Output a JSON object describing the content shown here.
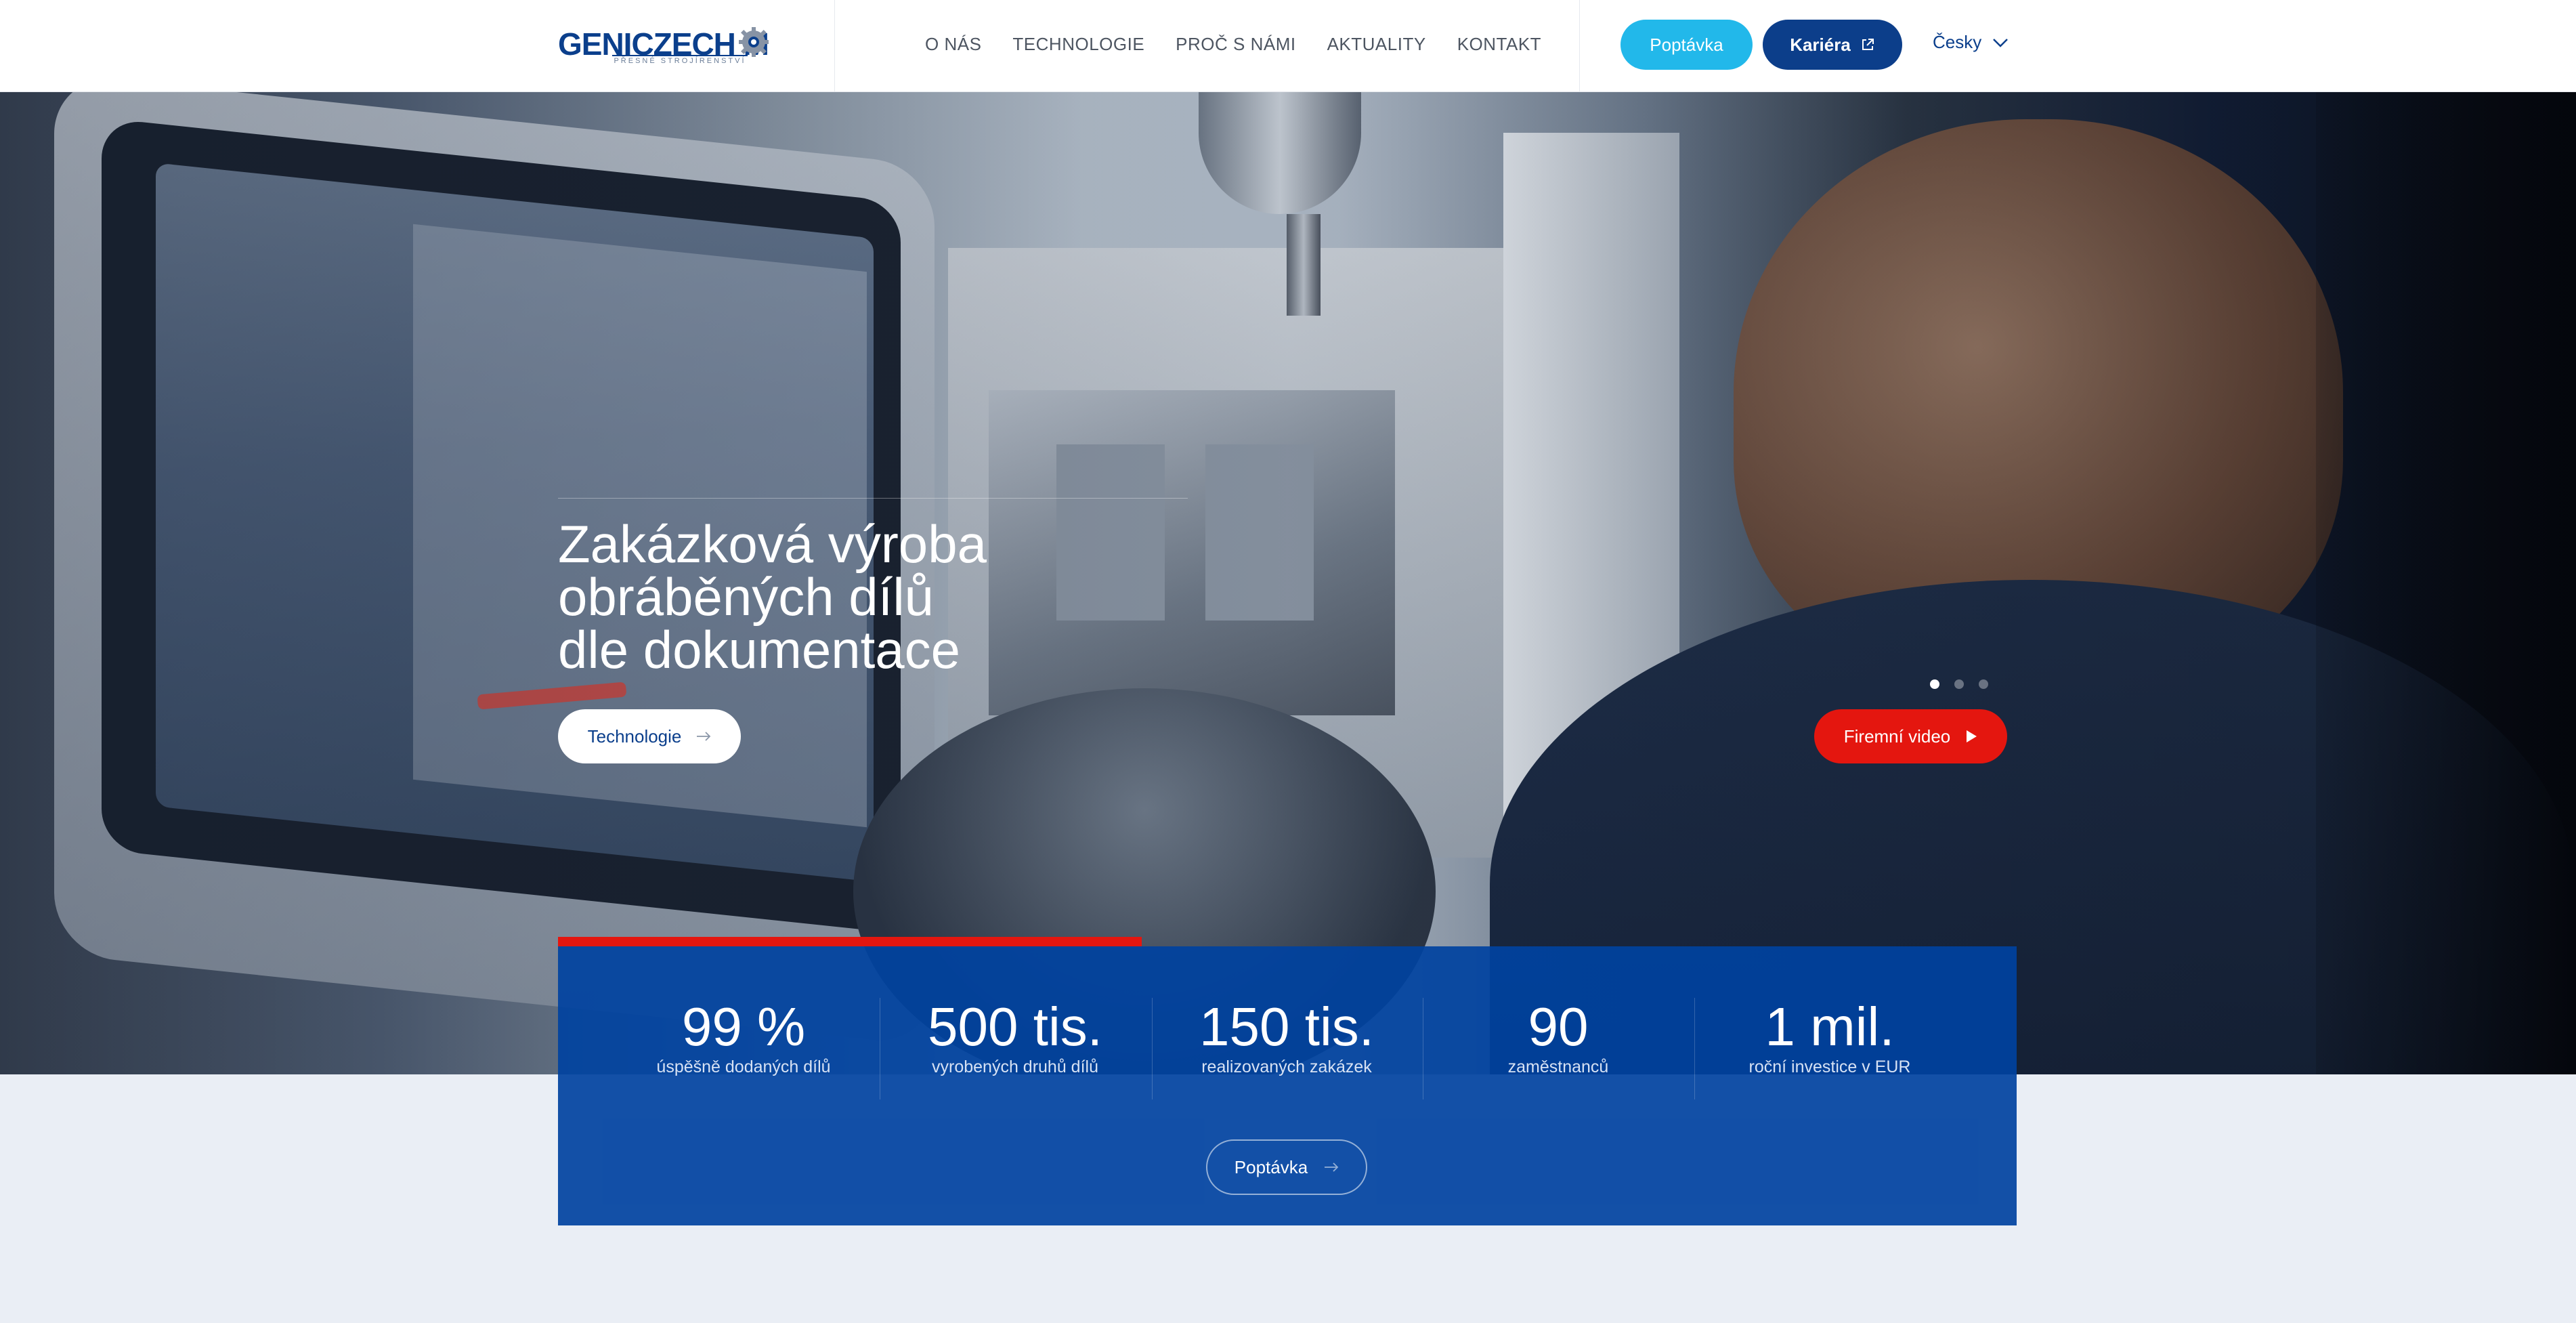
{
  "header": {
    "logo_text": "GENICZECH M",
    "logo_tagline": "PŘESNÉ STROJÍRENSTVÍ",
    "nav": [
      {
        "label": "O NÁS"
      },
      {
        "label": "TECHNOLOGIE"
      },
      {
        "label": "PROČ S NÁMI"
      },
      {
        "label": "AKTUALITY"
      },
      {
        "label": "KONTAKT"
      }
    ],
    "inquiry_label": "Poptávka",
    "career_label": "Kariéra",
    "language_label": "Česky"
  },
  "hero": {
    "title_lines": [
      "Zakázková výroba",
      "obráběných dílů",
      "dle dokumentace"
    ],
    "technology_button": "Technologie",
    "video_button": "Firemní video",
    "slides_total": 3,
    "slide_active": 1
  },
  "stats": {
    "progress_fraction": 0.4,
    "items": [
      {
        "value": "99 %",
        "label": "úspěšně dodaných dílů"
      },
      {
        "value": "500 tis.",
        "label": "vyrobených druhů dílů"
      },
      {
        "value": "150 tis.",
        "label": "realizovaných zakázek"
      },
      {
        "value": "90",
        "label": "zaměstnanců"
      },
      {
        "value": "1 mil.",
        "label": "roční investice v EUR"
      }
    ],
    "inquiry_label": "Poptávka"
  },
  "colors": {
    "brand_blue": "#0b3f8c",
    "accent_cyan": "#22b8ea",
    "accent_red": "#e4160f",
    "stats_blue": "#0042a0"
  },
  "icons": {
    "logo": "gear-icon",
    "career": "external-link-icon",
    "language": "chevron-down-icon",
    "technology": "arrow-right-icon",
    "video": "play-icon",
    "inquiry": "arrow-right-icon"
  }
}
